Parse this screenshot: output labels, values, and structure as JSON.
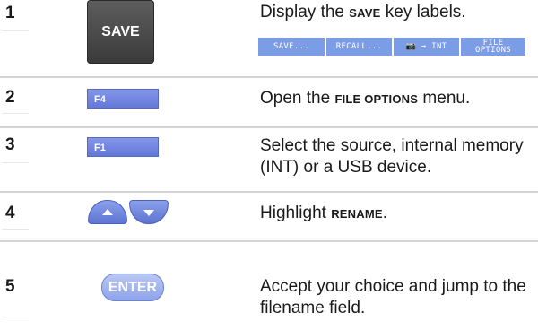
{
  "steps": [
    {
      "number": "1",
      "key": "SAVE",
      "desc_pre": "Display the ",
      "desc_bold": "SAVE",
      "desc_post": " key labels.",
      "softkeys": [
        "SAVE...",
        "RECALL...",
        "📷 → INT",
        "FILE OPTIONS"
      ]
    },
    {
      "number": "2",
      "key": "F4",
      "desc_pre": "Open the ",
      "desc_bold": "FILE OPTIONS",
      "desc_post": " menu."
    },
    {
      "number": "3",
      "key": "F1",
      "desc_pre": "Select the source, internal memory (INT) or a USB device.",
      "desc_bold": "",
      "desc_post": ""
    },
    {
      "number": "4",
      "key_icons": [
        "arrow-up-icon",
        "arrow-down-icon"
      ],
      "desc_pre": "Highlight ",
      "desc_bold": "RENAME",
      "desc_post": "."
    },
    {
      "number": "5",
      "key": "ENTER",
      "desc_pre": "Accept your choice and jump to the filename field.",
      "desc_bold": "",
      "desc_post": ""
    }
  ],
  "colors": {
    "softkey_bg": "#7a9de6",
    "fkey_bg": "#7083e0",
    "save_key_bg": "#4a4a4a",
    "separator": "#d4d4d4"
  }
}
